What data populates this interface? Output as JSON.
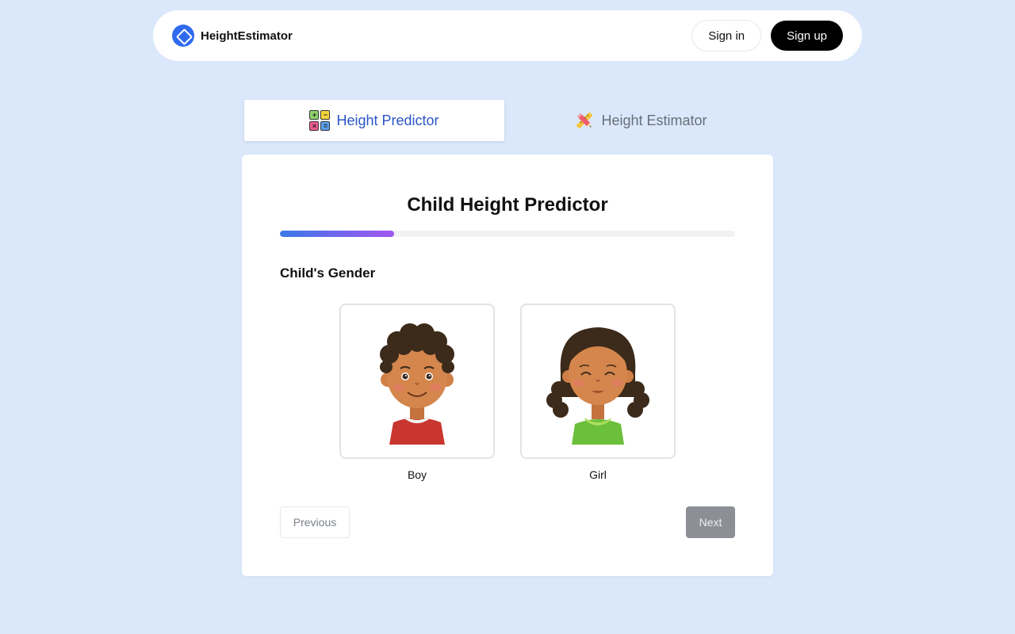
{
  "nav": {
    "brand": "HeightEstimator",
    "signin_label": "Sign in",
    "signup_label": "Sign up"
  },
  "tabs": [
    {
      "label": "Height Predictor",
      "active": true
    },
    {
      "label": "Height Estimator",
      "active": false
    }
  ],
  "card": {
    "title": "Child Height Predictor",
    "progress": 0.25,
    "section_label": "Child's Gender",
    "options": [
      {
        "label": "Boy"
      },
      {
        "label": "Girl"
      }
    ],
    "prev_label": "Previous",
    "next_label": "Next"
  },
  "colors": {
    "accent": "#2b55c8",
    "background": "#dbe8fb",
    "progress_start": "#3b78e7",
    "progress_end": "#a256f0"
  },
  "icons": {
    "brand": "diamond-logo-icon",
    "tab_predictor": "calculator-icon",
    "tab_estimator": "pencil-ruler-icon"
  }
}
